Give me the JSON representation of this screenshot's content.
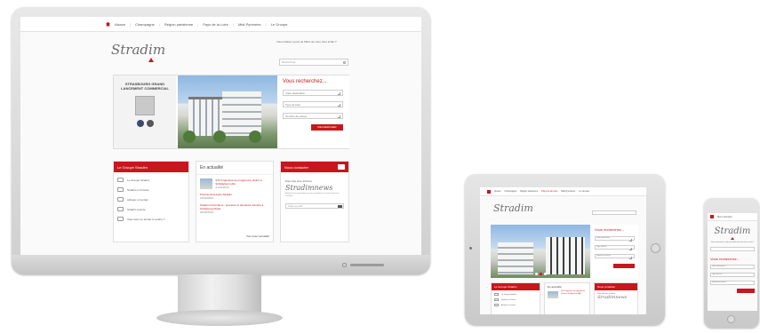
{
  "site": {
    "brand": "Stradim",
    "accent_color": "#c8161d",
    "nav": [
      "Alsace",
      "Champagne",
      "Région parisienne",
      "Pays de la Loire",
      "Midi-Pyrénées",
      "Le Groupe"
    ],
    "tagline": "Vous habitez à plus de 50km de votre futur achat ?",
    "search_placeholder": "Rechercher",
    "banner": {
      "title": "STRASBOURG GRAND LANCEMENT COMMERCIAL"
    },
    "search_panel": {
      "title": "Vous recherchez...",
      "fields": [
        "Votre destination",
        "Type de bien",
        "Nombre de pièces"
      ],
      "button": "RECHERCHER"
    },
    "group_box": {
      "title": "Le Groupe Stradim",
      "items": [
        "Le Groupe Stradim",
        "Stradim en France",
        "Acheter un terrain",
        "Stradim recrute",
        "Vous avez un terrain à vendre ?"
      ]
    },
    "news_box": {
      "title": "En actualité",
      "news": [
        {
          "title": "STO Ingénierie du programme Visitor à Schiltigheim (Ab)",
          "date": "21/10/2016"
        },
        {
          "title": "Premier Accession Stradim",
          "date": "18/06/2016"
        },
        {
          "title": "Stradim Colombiers : première et deuxième tranche à Strasbourg Pirate",
          "date": "22/09/2016"
        }
      ],
      "all_link": "Voir toute l'actualité"
    },
    "contact_box": {
      "title": "Nous contacter",
      "text": "Pour être tenu informé",
      "newsletter_brand": "Stradimnews",
      "small": "Abonnez-vous gratuitement à notre newsletter et recevez toutes nos actualités",
      "email_placeholder": "Votre e-mail"
    }
  },
  "tablet": {
    "nav": [
      "Alsace",
      "Champagne",
      "Région parisienne",
      "Pays de la Loire",
      "Midi-Pyrénées",
      "Le Groupe"
    ],
    "active_nav_index": 3
  },
  "phone": {
    "nav_label": "Menu principal",
    "phone_text": "Vous recherchez à plus de 50km de votre futur achat ?"
  }
}
